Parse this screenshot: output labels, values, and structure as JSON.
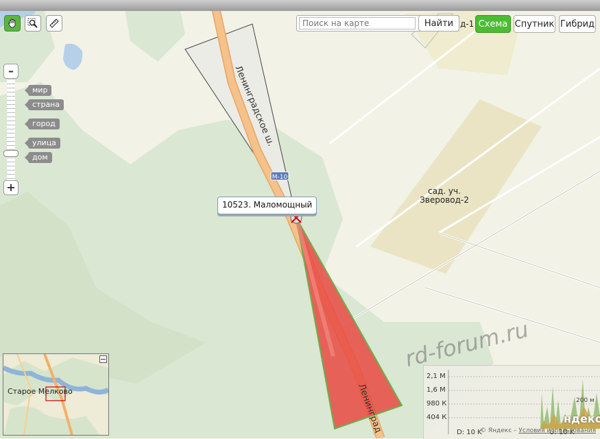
{
  "map": {
    "road_labels": [
      "Ленинградское ш.",
      "Ленинград"
    ],
    "route_badge": "М-10",
    "place_label": [
      "сад. уч.",
      "Зверовод-2"
    ],
    "edge_label": "д-1",
    "balloon": "10523. Маломощный"
  },
  "toolbar": {
    "tools": [
      "hand-icon",
      "magnifier-icon",
      "ruler-icon"
    ],
    "search_placeholder": "Поиск на карте",
    "search_button": "Найти",
    "layers": [
      "Схема",
      "Спутник",
      "Гибрид"
    ],
    "active_layer": "Схема"
  },
  "zoom": {
    "minus": "–",
    "plus": "+",
    "levels": [
      "мир",
      "страна",
      "город",
      "улица",
      "дом"
    ]
  },
  "minimap": {
    "label": "Старое Мелково"
  },
  "traffic": {
    "axis": [
      "2,1 М",
      "1,6 М",
      "980 К",
      "404 К"
    ],
    "d_label": "D: 10 K",
    "u_label": "U: 10 K",
    "logo": "ндекс",
    "scale": "200 м"
  },
  "copyright": {
    "text": "© Яндекс –",
    "link": "Условия использования"
  },
  "watermark": "rd-forum.ru",
  "colors": {
    "road": "#f2b97a",
    "sector_red": "#e8423c",
    "sector_grey": "#e8e8e2",
    "forest": "#d9e6d0",
    "active_layer": "#4cbc35"
  }
}
